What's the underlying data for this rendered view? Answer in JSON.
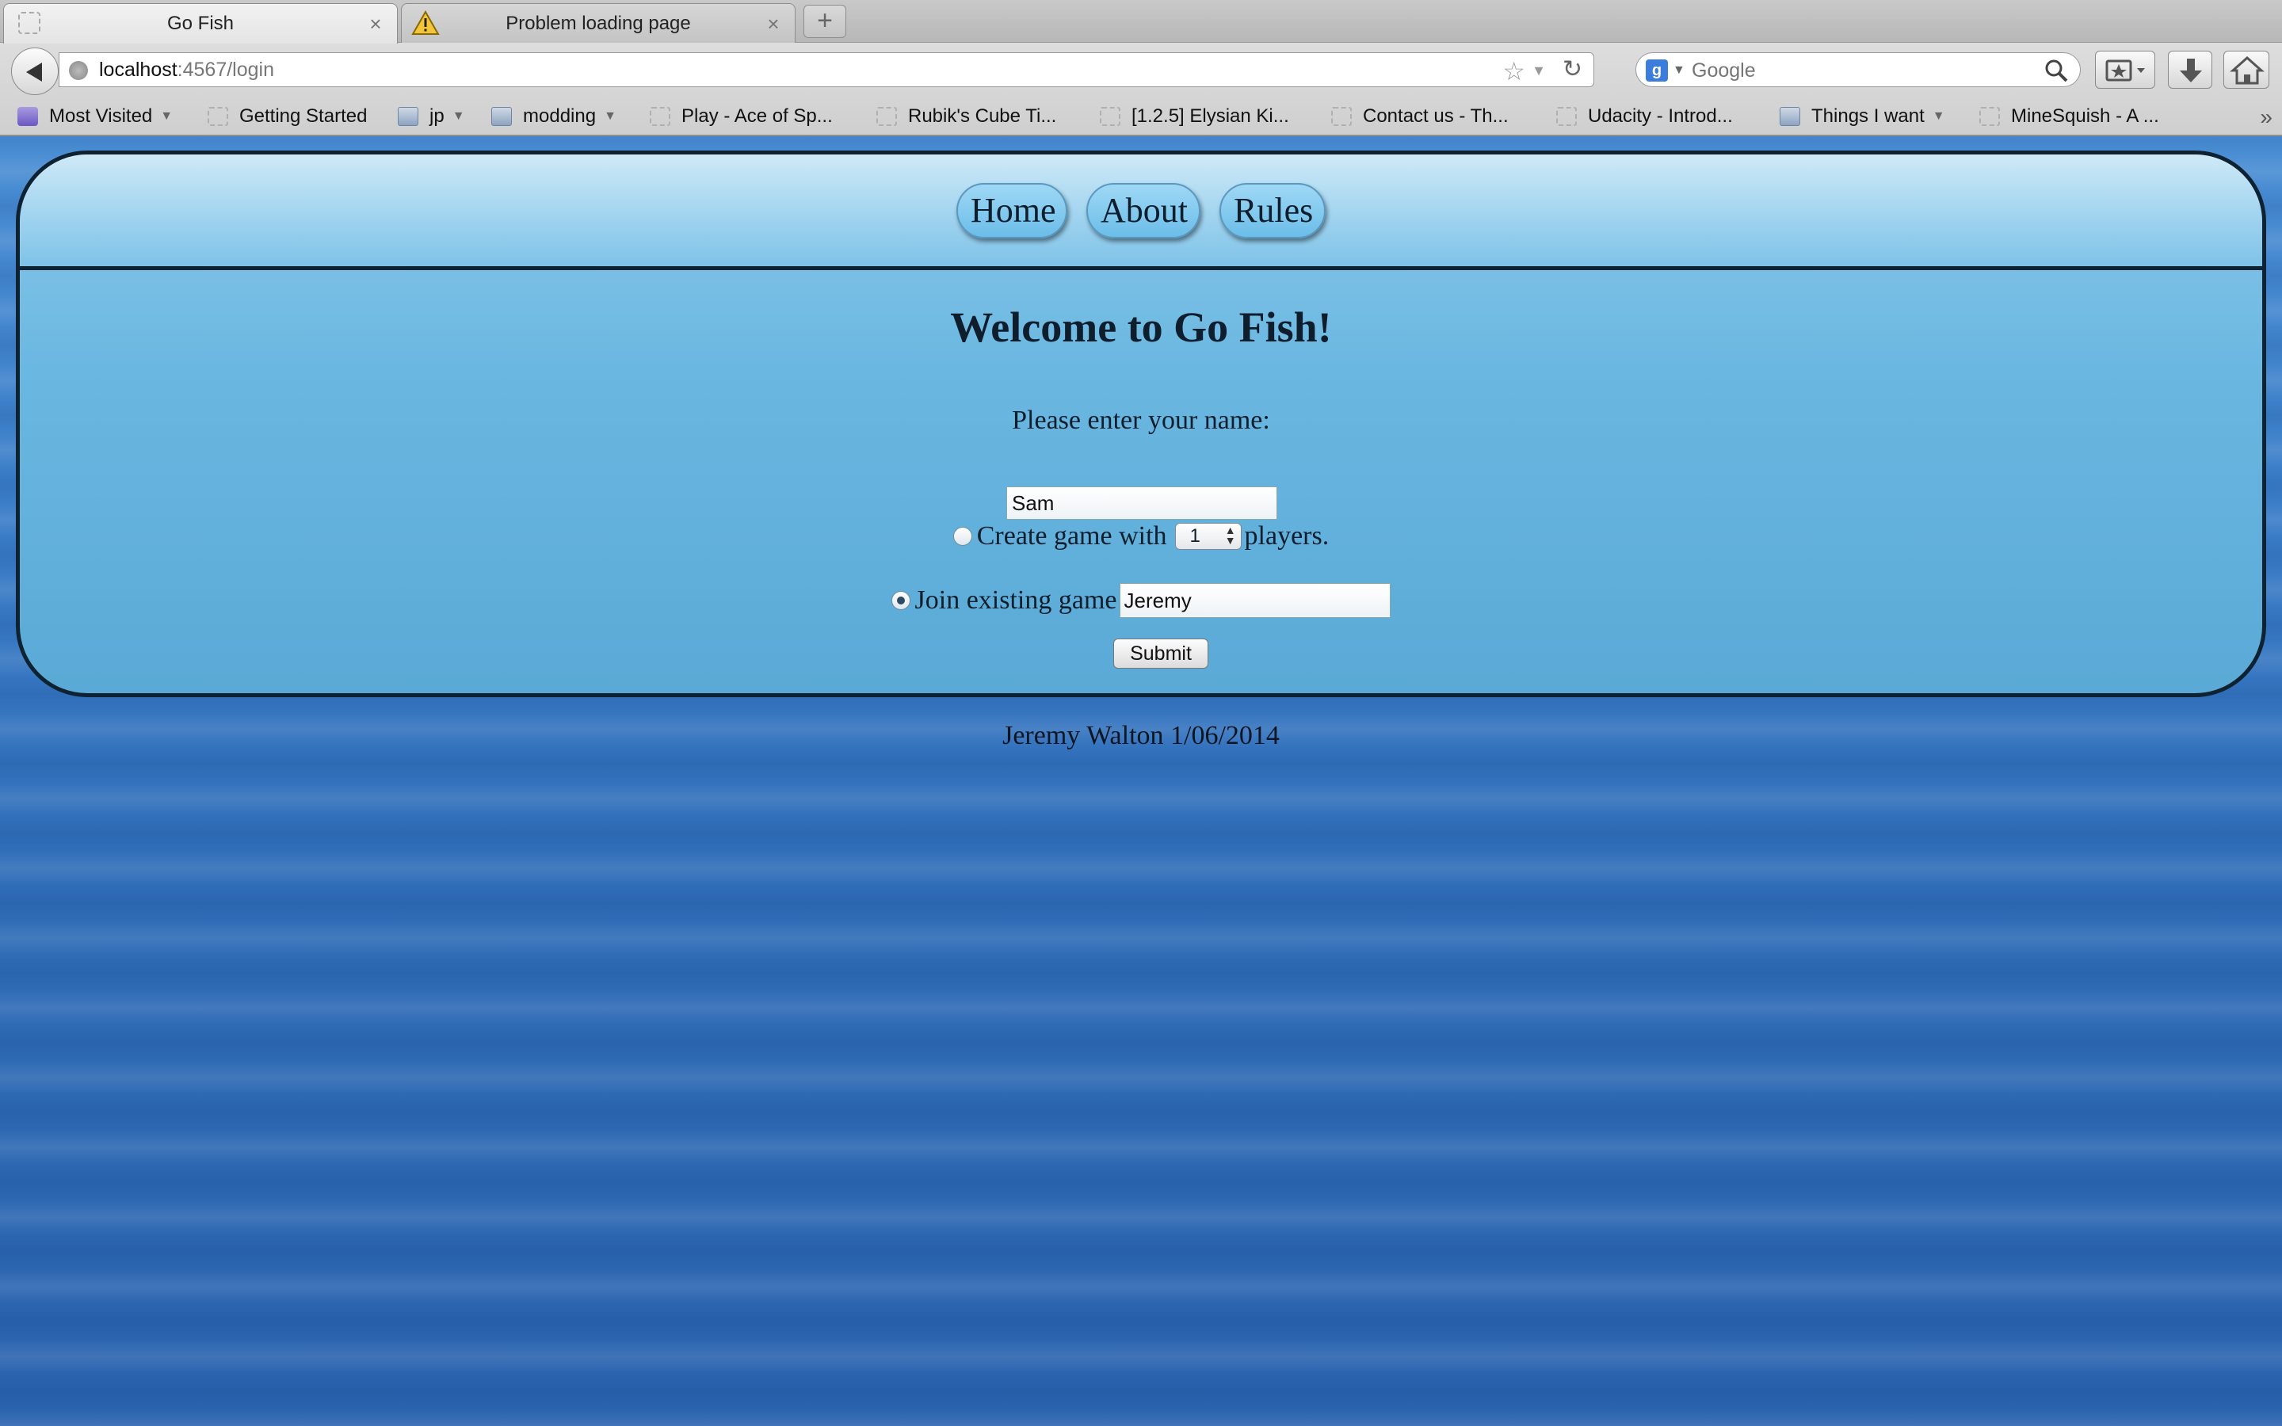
{
  "browser": {
    "tabs": [
      {
        "label": "Go Fish",
        "active": true
      },
      {
        "label": "Problem loading page",
        "active": false
      }
    ],
    "url": {
      "host": "localhost",
      "rest": ":4567/login"
    },
    "search": {
      "placeholder": "Google"
    },
    "bookmarks": [
      {
        "label": "Most Visited",
        "icon": "most-visited-icon",
        "menu": true
      },
      {
        "label": "Getting Started",
        "icon": "page-icon",
        "menu": false
      },
      {
        "label": "jp",
        "icon": "folder-icon",
        "menu": true
      },
      {
        "label": "modding",
        "icon": "folder-icon",
        "menu": true
      },
      {
        "label": "Play - Ace of Sp...",
        "icon": "page-icon",
        "menu": false
      },
      {
        "label": "Rubik's Cube Ti...",
        "icon": "page-icon",
        "menu": false
      },
      {
        "label": "[1.2.5] Elysian Ki...",
        "icon": "page-icon",
        "menu": false
      },
      {
        "label": "Contact us - Th...",
        "icon": "page-icon",
        "menu": false
      },
      {
        "label": "Udacity - Introd...",
        "icon": "page-icon",
        "menu": false
      },
      {
        "label": "Things I want",
        "icon": "folder-icon",
        "menu": true
      },
      {
        "label": "MineSquish - A ...",
        "icon": "page-icon",
        "menu": false
      }
    ],
    "overflow_glyph": "»"
  },
  "page": {
    "nav": {
      "home": "Home",
      "about": "About",
      "rules": "Rules"
    },
    "title": "Welcome to Go Fish!",
    "name_prompt": "Please enter your name:",
    "name_value": "Sam",
    "create": {
      "prefix": "Create game with",
      "players_value": "1",
      "suffix": "players.",
      "checked": false
    },
    "join": {
      "label": "Join existing game",
      "value": "Jeremy",
      "checked": true
    },
    "submit_label": "Submit",
    "footer": "Jeremy Walton 1/06/2014"
  }
}
